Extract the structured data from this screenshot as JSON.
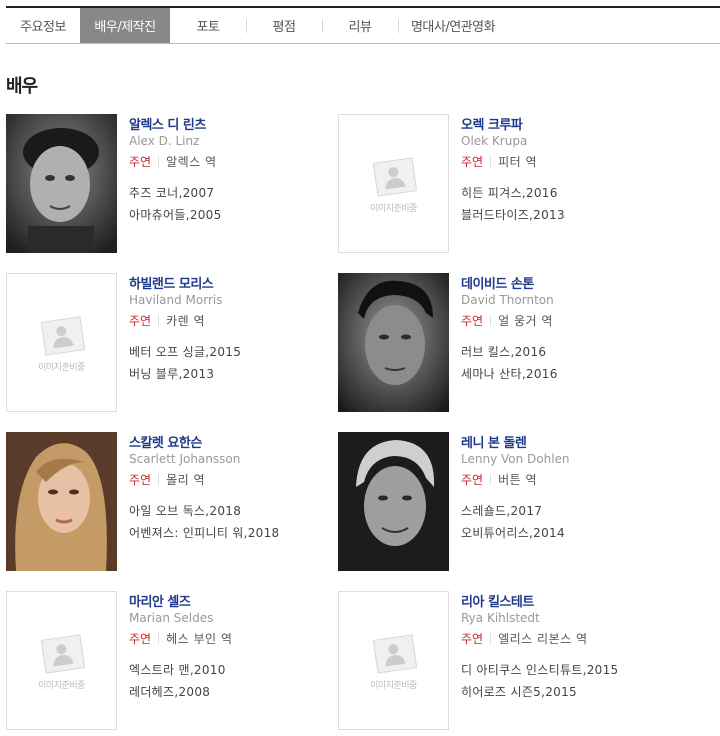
{
  "tabs": [
    {
      "label": "주요정보",
      "active": false
    },
    {
      "label": "배우/제작진",
      "active": true
    },
    {
      "label": "포토",
      "active": false
    },
    {
      "label": "평점",
      "active": false
    },
    {
      "label": "리뷰",
      "active": false
    },
    {
      "label": "명대사/연관영화",
      "active": false
    }
  ],
  "section_title": "배우",
  "placeholder_text": "이미지준비중",
  "actors": [
    {
      "name": "알렉스 디 린츠",
      "name_en": "Alex D. Linz",
      "role_type": "주연",
      "role": "알렉스 역",
      "films": [
        "추즈 코너,2007",
        "아마츄어들,2005"
      ],
      "has_photo": true
    },
    {
      "name": "오렉 크루파",
      "name_en": "Olek Krupa",
      "role_type": "주연",
      "role": "피터 역",
      "films": [
        "히든 피겨스,2016",
        "블러드타이즈,2013"
      ],
      "has_photo": false
    },
    {
      "name": "하빌랜드 모리스",
      "name_en": "Haviland Morris",
      "role_type": "주연",
      "role": "카렌 역",
      "films": [
        "베터 오프 싱글,2015",
        "버닝 블루,2013"
      ],
      "has_photo": false
    },
    {
      "name": "데이비드 손톤",
      "name_en": "David Thornton",
      "role_type": "주연",
      "role": "얼 웅거 역",
      "films": [
        "러브 킬스,2016",
        "세마나 산타,2016"
      ],
      "has_photo": true
    },
    {
      "name": "스칼렛 요한슨",
      "name_en": "Scarlett Johansson",
      "role_type": "주연",
      "role": "몰리 역",
      "films": [
        "아일 오브 독스,2018",
        "어벤져스: 인피니티 워,2018"
      ],
      "has_photo": true
    },
    {
      "name": "레니 본 돌렌",
      "name_en": "Lenny Von Dohlen",
      "role_type": "주연",
      "role": "버튼 역",
      "films": [
        "스레숄드,2017",
        "오비튜어리스,2014"
      ],
      "has_photo": true
    },
    {
      "name": "마리안 셀즈",
      "name_en": "Marian Seldes",
      "role_type": "주연",
      "role": "헤스 부인 역",
      "films": [
        "엑스트라 맨,2010",
        "레더헤즈,2008"
      ],
      "has_photo": false
    },
    {
      "name": "리아 킬스테트",
      "name_en": "Rya Kihlstedt",
      "role_type": "주연",
      "role": "엘리스 리본스 역",
      "films": [
        "디 아티쿠스 인스티튜트,2015",
        "히어로즈 시즌5,2015"
      ],
      "has_photo": false
    }
  ]
}
